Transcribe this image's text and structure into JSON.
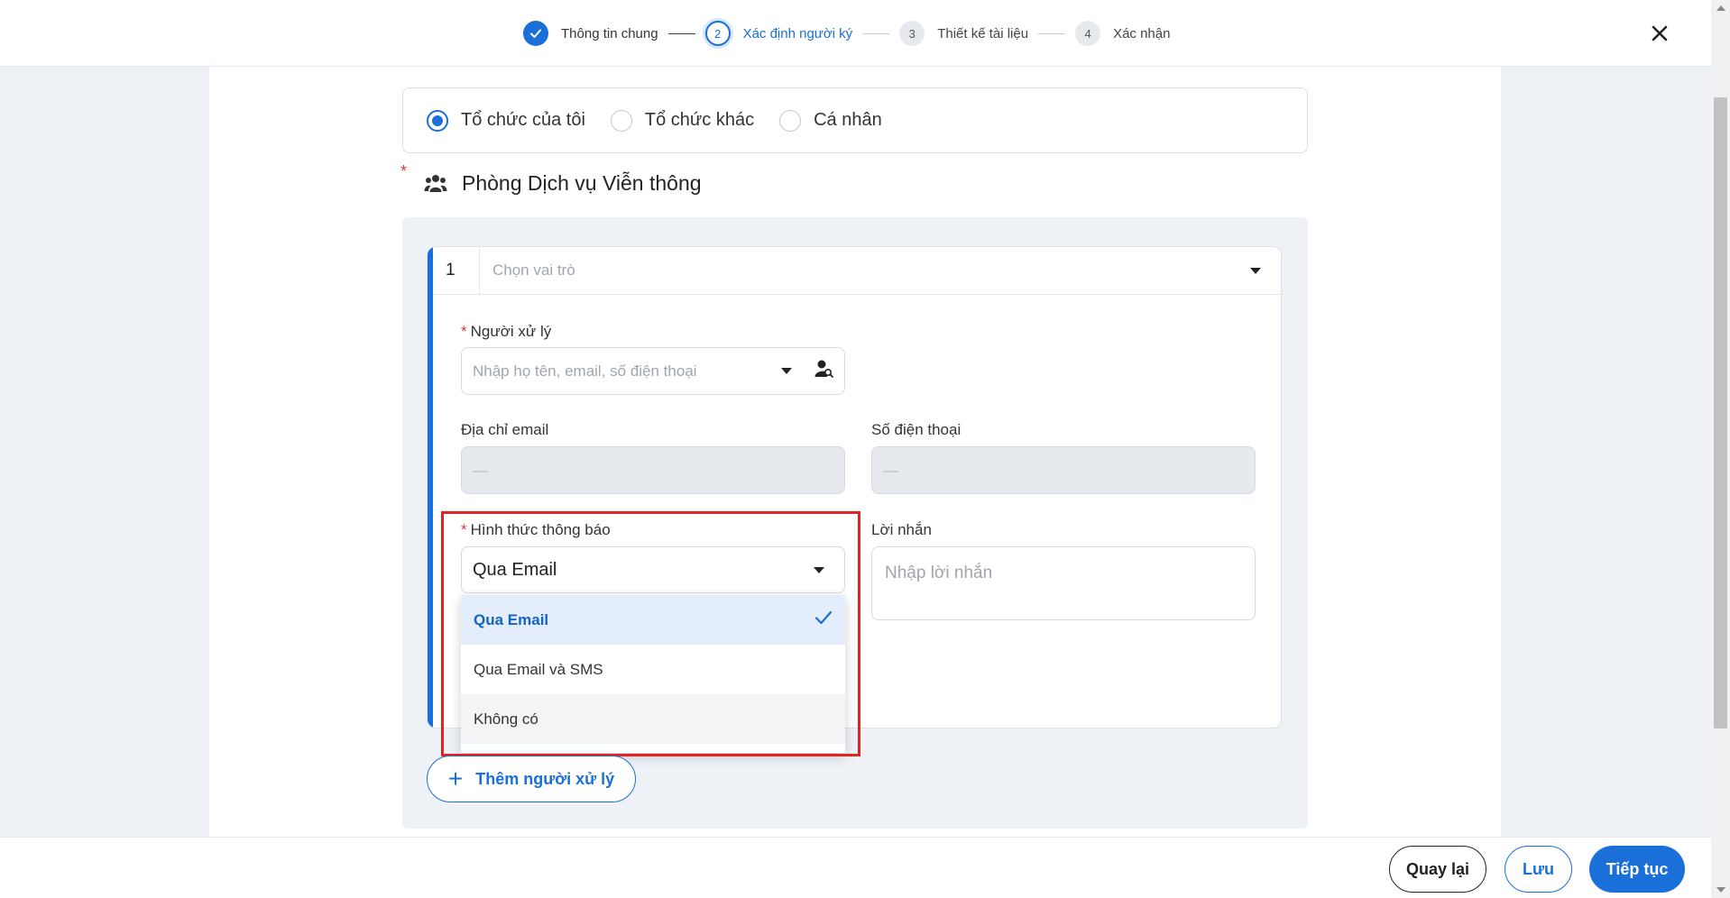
{
  "stepper": {
    "steps": [
      {
        "number": "",
        "label": "Thông tin chung",
        "state": "done"
      },
      {
        "number": "2",
        "label": "Xác định người ký",
        "state": "active"
      },
      {
        "number": "3",
        "label": "Thiết kế tài liệu",
        "state": "todo"
      },
      {
        "number": "4",
        "label": "Xác nhận",
        "state": "todo"
      }
    ]
  },
  "signer_type": {
    "options": [
      {
        "label": "Tổ chức của tôi",
        "checked": true
      },
      {
        "label": "Tổ chức khác",
        "checked": false
      },
      {
        "label": "Cá nhân",
        "checked": false
      }
    ]
  },
  "organization": {
    "required_mark": "*",
    "name": "Phòng Dịch vụ Viễn thông",
    "icon": "users-icon"
  },
  "signer": {
    "order": "1",
    "role_placeholder": "Chọn vai trò",
    "handler": {
      "required_mark": "*",
      "label": "Người xử lý",
      "placeholder": "Nhập họ tên, email, số điện thoại"
    },
    "email": {
      "label": "Địa chỉ email",
      "value": "—"
    },
    "phone": {
      "label": "Số điện thoại",
      "value": "—"
    },
    "notification": {
      "required_mark": "*",
      "label": "Hình thức thông báo",
      "value": "Qua Email",
      "options": [
        {
          "label": "Qua Email",
          "selected": true
        },
        {
          "label": "Qua Email và SMS",
          "selected": false
        },
        {
          "label": "Không có",
          "selected": false
        }
      ]
    },
    "message": {
      "label": "Lời nhắn",
      "placeholder": "Nhập lời nhắn"
    }
  },
  "add_handler_label": "Thêm người xử lý",
  "footer": {
    "back": "Quay lại",
    "save": "Lưu",
    "next": "Tiếp tục"
  },
  "colors": {
    "primary": "#1a6fd9",
    "required": "#e53935",
    "highlight": "#e02424"
  }
}
